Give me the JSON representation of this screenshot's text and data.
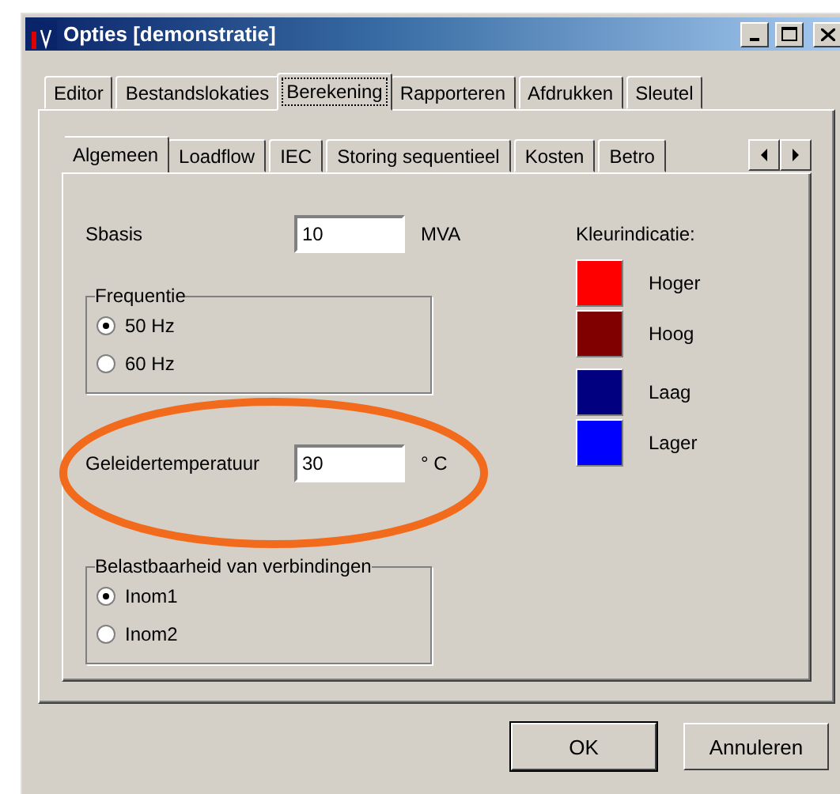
{
  "window": {
    "title": "Opties [demonstratie]"
  },
  "tabs": [
    {
      "label": "Editor",
      "selected": false
    },
    {
      "label": "Bestandslokaties",
      "selected": false
    },
    {
      "label": "Berekening",
      "selected": true
    },
    {
      "label": "Rapporteren",
      "selected": false
    },
    {
      "label": "Afdrukken",
      "selected": false
    },
    {
      "label": "Sleutel",
      "selected": false
    }
  ],
  "subtabs": [
    {
      "label": "Algemeen",
      "selected": true
    },
    {
      "label": "Loadflow",
      "selected": false
    },
    {
      "label": "IEC",
      "selected": false
    },
    {
      "label": "Storing sequentieel",
      "selected": false
    },
    {
      "label": "Kosten",
      "selected": false
    },
    {
      "label": "Betro",
      "selected": false
    }
  ],
  "sbasis": {
    "label": "Sbasis",
    "value": "10",
    "unit": "MVA"
  },
  "frequency": {
    "legend": "Frequentie",
    "options": [
      {
        "label": "50 Hz",
        "selected": true
      },
      {
        "label": "60 Hz",
        "selected": false
      }
    ]
  },
  "conductor_temperature": {
    "label": "Geleidertemperatuur",
    "value": "30",
    "unit": "° C",
    "highlighted": true
  },
  "load_capacity": {
    "legend": "Belastbaarheid van verbindingen",
    "options": [
      {
        "label": "Inom1",
        "selected": true
      },
      {
        "label": "Inom2",
        "selected": false
      }
    ]
  },
  "color_legend": {
    "title": "Kleurindicatie:",
    "groups": [
      {
        "items": [
          {
            "label": "Hoger",
            "color": "#ff0000"
          },
          {
            "label": "Hoog",
            "color": "#800000"
          }
        ]
      },
      {
        "items": [
          {
            "label": "Laag",
            "color": "#000080"
          },
          {
            "label": "Lager",
            "color": "#0000ff"
          }
        ]
      }
    ]
  },
  "buttons": [
    {
      "label": "OK",
      "default": true
    },
    {
      "label": "Annuleren",
      "default": false
    }
  ]
}
